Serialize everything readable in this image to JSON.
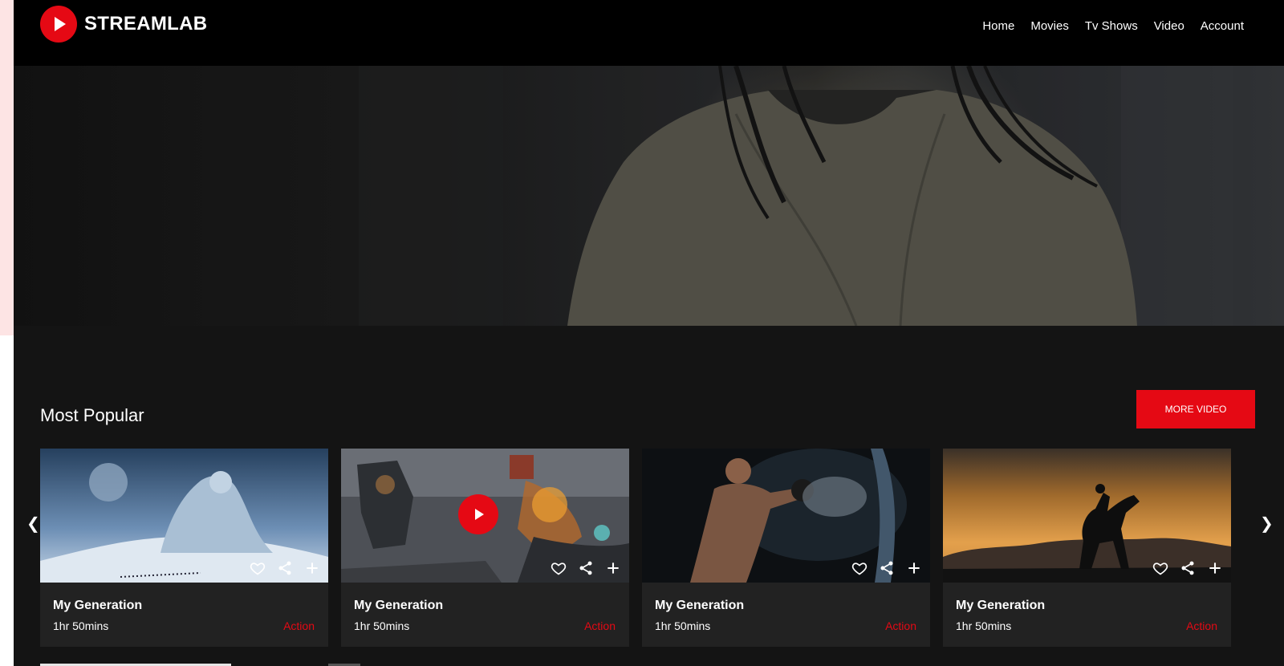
{
  "brand": {
    "name": "STREAMLAB",
    "accent": "#e50914"
  },
  "nav": {
    "items": [
      "Home",
      "Movies",
      "Tv Shows",
      "Video",
      "Account"
    ]
  },
  "section": {
    "title": "Most Popular",
    "more_label": "MORE VIDEO"
  },
  "carousel": {
    "prev_icon": "❮",
    "next_icon": "❯",
    "cards": [
      {
        "title": "My Generation",
        "duration": "1hr 50mins",
        "genre": "Action",
        "image": "ice-giant-scene"
      },
      {
        "title": "My Generation",
        "duration": "1hr 50mins",
        "genre": "Action",
        "image": "robot-battle-scene",
        "has_play": true
      },
      {
        "title": "My Generation",
        "duration": "1hr 50mins",
        "genre": "Action",
        "image": "boxer-scene"
      },
      {
        "title": "My Generation",
        "duration": "1hr 50mins",
        "genre": "Action",
        "image": "horse-rider-sunset-scene"
      }
    ]
  },
  "icons": [
    "play-icon",
    "heart-icon",
    "share-icon",
    "plus-icon"
  ]
}
